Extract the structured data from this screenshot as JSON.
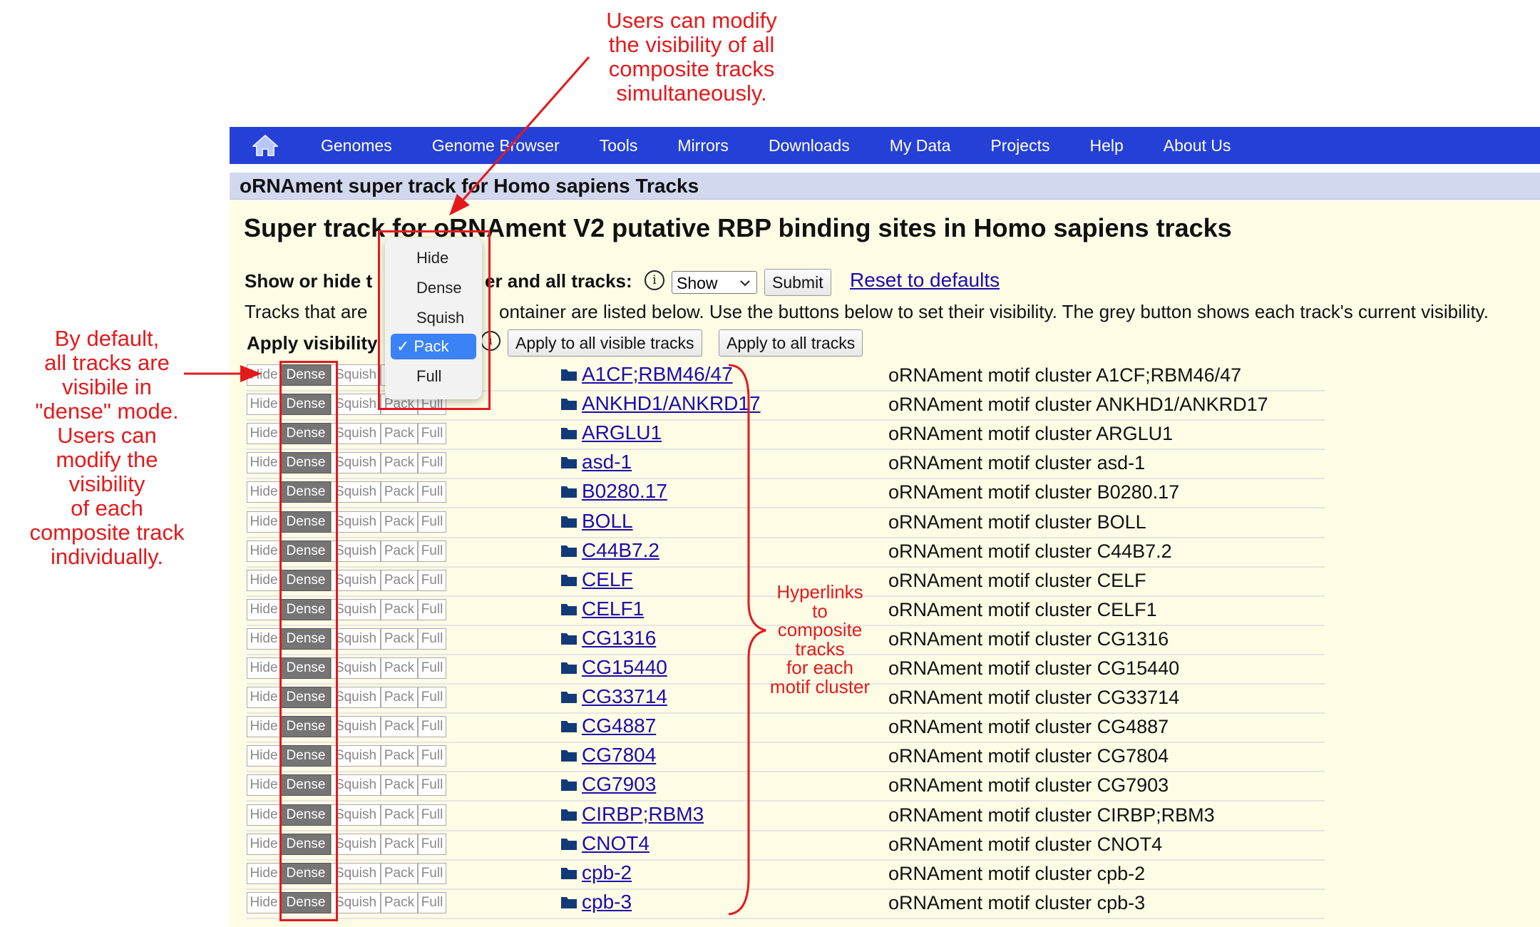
{
  "nav": {
    "items": [
      "Genomes",
      "Genome Browser",
      "Tools",
      "Mirrors",
      "Downloads",
      "My Data",
      "Projects",
      "Help",
      "About Us"
    ],
    "home_icon": "home-icon",
    "background_color": "#2540d6"
  },
  "section_header": "oRNAment super track for Homo sapiens Tracks",
  "heading": "Super track for oRNAment V2 putative RBP binding sites in Homo sapiens tracks",
  "controls": {
    "show_hide_prefix": "Show or hide t",
    "show_hide_suffix": "er and all tracks:",
    "show_select_value": "Show",
    "submit_label": "Submit",
    "reset_label": "Reset to defaults",
    "tracks_info_prefix": "Tracks that are",
    "tracks_info_suffix": "ontainer are listed below. Use the buttons below to set their visibility. The grey button shows each track's current visibility.",
    "apply_visibility_label": "Apply visibility",
    "apply_visible_label": "Apply to all visible tracks",
    "apply_all_label": "Apply to all tracks"
  },
  "dropdown": {
    "options": [
      "Hide",
      "Dense",
      "Squish",
      "Pack",
      "Full"
    ],
    "selected": "Pack",
    "selected_display": "✓ Pack",
    "highlight_color": "#3a82f6"
  },
  "visibility_buttons": {
    "hide": "Hide",
    "dense": "Dense",
    "squish": "Squish",
    "pack": "Pack",
    "full": "Full",
    "active": "Dense"
  },
  "tracks": [
    {
      "name": "A1CF;RBM46/47",
      "description": "oRNAment motif cluster A1CF;RBM46/47"
    },
    {
      "name": "ANKHD1/ANKRD17",
      "description": "oRNAment motif cluster ANKHD1/ANKRD17"
    },
    {
      "name": "ARGLU1",
      "description": "oRNAment motif cluster ARGLU1"
    },
    {
      "name": "asd-1",
      "description": "oRNAment motif cluster asd-1"
    },
    {
      "name": "B0280.17",
      "description": "oRNAment motif cluster B0280.17"
    },
    {
      "name": "BOLL",
      "description": "oRNAment motif cluster BOLL"
    },
    {
      "name": "C44B7.2",
      "description": "oRNAment motif cluster C44B7.2"
    },
    {
      "name": "CELF",
      "description": "oRNAment motif cluster CELF"
    },
    {
      "name": "CELF1",
      "description": "oRNAment motif cluster CELF1"
    },
    {
      "name": "CG1316",
      "description": "oRNAment motif cluster CG1316"
    },
    {
      "name": "CG15440",
      "description": "oRNAment motif cluster CG15440"
    },
    {
      "name": "CG33714",
      "description": "oRNAment motif cluster CG33714"
    },
    {
      "name": "CG4887",
      "description": "oRNAment motif cluster CG4887"
    },
    {
      "name": "CG7804",
      "description": "oRNAment motif cluster CG7804"
    },
    {
      "name": "CG7903",
      "description": "oRNAment motif cluster CG7903"
    },
    {
      "name": "CIRBP;RBM3",
      "description": "oRNAment motif cluster CIRBP;RBM3"
    },
    {
      "name": "CNOT4",
      "description": "oRNAment motif cluster CNOT4"
    },
    {
      "name": "cpb-2",
      "description": "oRNAment motif cluster cpb-2"
    },
    {
      "name": "cpb-3",
      "description": "oRNAment motif cluster cpb-3"
    }
  ],
  "annotations": {
    "top": [
      "Users can modify",
      "the visibility of all",
      "composite tracks",
      "simultaneously."
    ],
    "left": [
      "By default,",
      "all tracks are",
      "visibile in",
      "\"dense\" mode.",
      "Users can",
      "modify the",
      "visibility",
      "of each",
      "composite track",
      "individually."
    ],
    "middle": [
      "Hyperlinks",
      "to",
      "composite",
      "tracks",
      "for each",
      "motif cluster"
    ],
    "color": "#e31a1c"
  }
}
